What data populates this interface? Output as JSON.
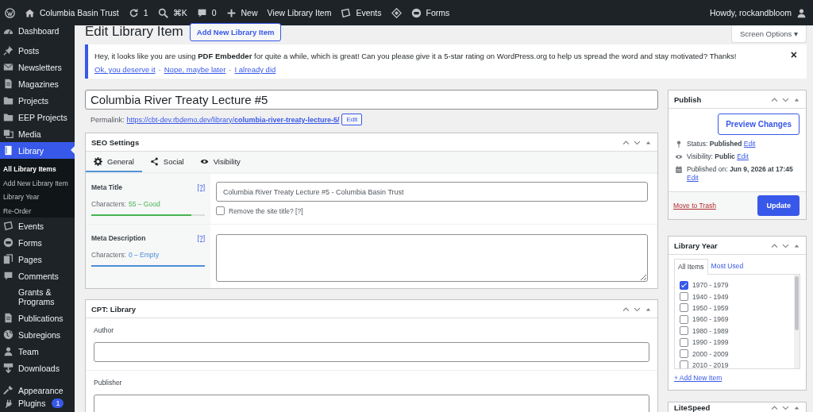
{
  "admin_bar": {
    "items": [
      {
        "label": "Columbia Basin Trust"
      },
      {
        "label": "1"
      },
      {
        "label": "⌘K"
      },
      {
        "label": "0"
      },
      {
        "label": "New"
      },
      {
        "label": "View Library Item"
      },
      {
        "label": "Events"
      },
      {
        "label": "Forms"
      }
    ],
    "greeting": "Howdy, rockandbloom"
  },
  "sidebar": {
    "items": [
      {
        "label": "Dashboard",
        "selected": false
      },
      {
        "label": "Posts",
        "selected": false
      },
      {
        "label": "Newsletters",
        "selected": false
      },
      {
        "label": "Magazines",
        "selected": false
      },
      {
        "label": "Projects",
        "selected": false
      },
      {
        "label": "EEP Projects",
        "selected": false
      },
      {
        "label": "Media",
        "selected": false
      },
      {
        "label": "Library",
        "selected": true,
        "children": [
          {
            "label": "All Library Items",
            "selected": true
          },
          {
            "label": "Add New Library Item",
            "selected": false
          },
          {
            "label": "Library Year",
            "selected": false
          },
          {
            "label": "Re-Order",
            "selected": false
          }
        ]
      },
      {
        "label": "Events",
        "selected": false
      },
      {
        "label": "Forms",
        "selected": false
      },
      {
        "label": "Pages",
        "selected": false
      },
      {
        "label": "Comments",
        "selected": false
      },
      {
        "label": "Grants & Programs",
        "selected": false
      },
      {
        "label": "Publications",
        "selected": false
      },
      {
        "label": "Subregions",
        "selected": false
      },
      {
        "label": "Team",
        "selected": false
      },
      {
        "label": "Downloads",
        "selected": false
      },
      {
        "label": "Appearance",
        "selected": false
      },
      {
        "label": "Plugins",
        "selected": false,
        "badge": "1"
      }
    ]
  },
  "header": {
    "title": "Edit Library Item",
    "add_button": "Add New Library Item",
    "screen_options": "Screen Options ▾"
  },
  "notice": {
    "text": "Hey, it looks like you are using **PDF Embedder** for quite a while, which is great! Can you please give it a 5-star rating on WordPress.org to help us spread the word and stay motivated? Thanks!",
    "links": [
      "Ok, you deserve it",
      "Nope, maybe later",
      "I already did"
    ],
    "separator": "·",
    "dismiss": "×"
  },
  "title_field": {
    "value": "Columbia River Treaty Lecture #5"
  },
  "permalink": {
    "label": "Permalink:",
    "url": "https://cbt-dev.rbdemo.dev/library/**columbia-river-treaty-lecture-5/**",
    "edit": "Edit"
  },
  "seo_box": {
    "title": "SEO Settings",
    "tabs": [
      {
        "label": "General",
        "selected": true
      },
      {
        "label": "Social",
        "selected": false
      },
      {
        "label": "Visibility",
        "selected": false
      }
    ],
    "fields": [
      {
        "kind": "input",
        "label": "Meta Title",
        "help": "[?]",
        "count_label": "Characters:",
        "count": "55 – Good",
        "color": "#46b450",
        "level": 0.88,
        "value": "Columbia River Treaty Lecture #5 - Columbia Basin Trust",
        "checkbox": {
          "label": "Remove the site title? [?]",
          "checked": false
        }
      },
      {
        "kind": "textarea",
        "label": "Meta Description",
        "help": "[?]",
        "count_label": "Characters:",
        "count": "0 – Empty",
        "color": "#4a8fd9",
        "level": 1
      }
    ]
  },
  "cpt_box": {
    "title": "CPT: Library",
    "fields": [
      {
        "label": "Author"
      },
      {
        "label": "Publisher"
      }
    ]
  },
  "publish_box": {
    "title": "Publish",
    "preview": "Preview Changes",
    "rows": [
      {
        "label": "Status:",
        "value": "Published",
        "edit": "Edit"
      },
      {
        "label": "Visibility:",
        "value": "Public",
        "edit": "Edit"
      },
      {
        "label": "Published on:",
        "value": "Jun 9, 2026 at 17:45",
        "edit": "Edit"
      }
    ],
    "trash": "Move to Trash",
    "update": "Update"
  },
  "year_box": {
    "title": "Library Year",
    "tabs": [
      {
        "label": "All Items",
        "selected": true
      },
      {
        "label": "Most Used",
        "selected": false
      }
    ],
    "items": [
      {
        "label": "1970 - 1979",
        "checked": true
      },
      {
        "label": "1940 - 1949",
        "checked": false
      },
      {
        "label": "1950 - 1959",
        "checked": false
      },
      {
        "label": "1960 - 1969",
        "checked": false
      },
      {
        "label": "1980 - 1989",
        "checked": false
      },
      {
        "label": "1990 - 1999",
        "checked": false
      },
      {
        "label": "2000 - 2009",
        "checked": false
      },
      {
        "label": "2010 - 2019",
        "checked": false
      }
    ],
    "add_link": "+ Add New Item"
  },
  "litespeed_box": {
    "title": "LiteSpeed"
  }
}
